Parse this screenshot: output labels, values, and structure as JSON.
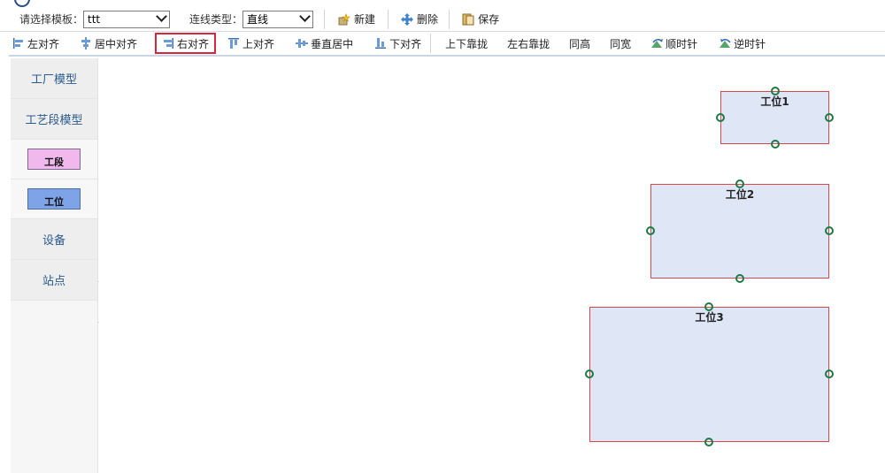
{
  "toolbar1": {
    "template_label": "请选择模板：",
    "template_value": "ttt",
    "line_type_label": "连线类型：",
    "line_type_value": "直线",
    "new_label": "新建",
    "delete_label": "删除",
    "save_label": "保存"
  },
  "toolbar2": {
    "align_left": "左对齐",
    "align_center": "居中对齐",
    "align_right": "右对齐",
    "align_top": "上对齐",
    "align_vcenter": "垂直居中",
    "align_bottom": "下对齐",
    "dock_vertical": "上下靠拢",
    "dock_horizontal": "左右靠拢",
    "same_height": "同高",
    "same_width": "同宽",
    "rotate_cw": "顺时针",
    "rotate_ccw": "逆时针"
  },
  "sidebar": {
    "factory_model": "工厂模型",
    "process_model": "工艺段模型",
    "section_shape": "工段",
    "station_shape": "工位",
    "equipment": "设备",
    "site": "站点"
  },
  "canvas": {
    "nodes": [
      {
        "label": "工位1"
      },
      {
        "label": "工位2"
      },
      {
        "label": "工位3"
      }
    ]
  },
  "colors": {
    "node_fill": "#dfe6f6",
    "node_border": "#d9474e",
    "anchor": "#1e7a45",
    "section_fill": "#f0b8ec",
    "station_fill": "#7ea3e6",
    "active_border": "#d3283d"
  }
}
